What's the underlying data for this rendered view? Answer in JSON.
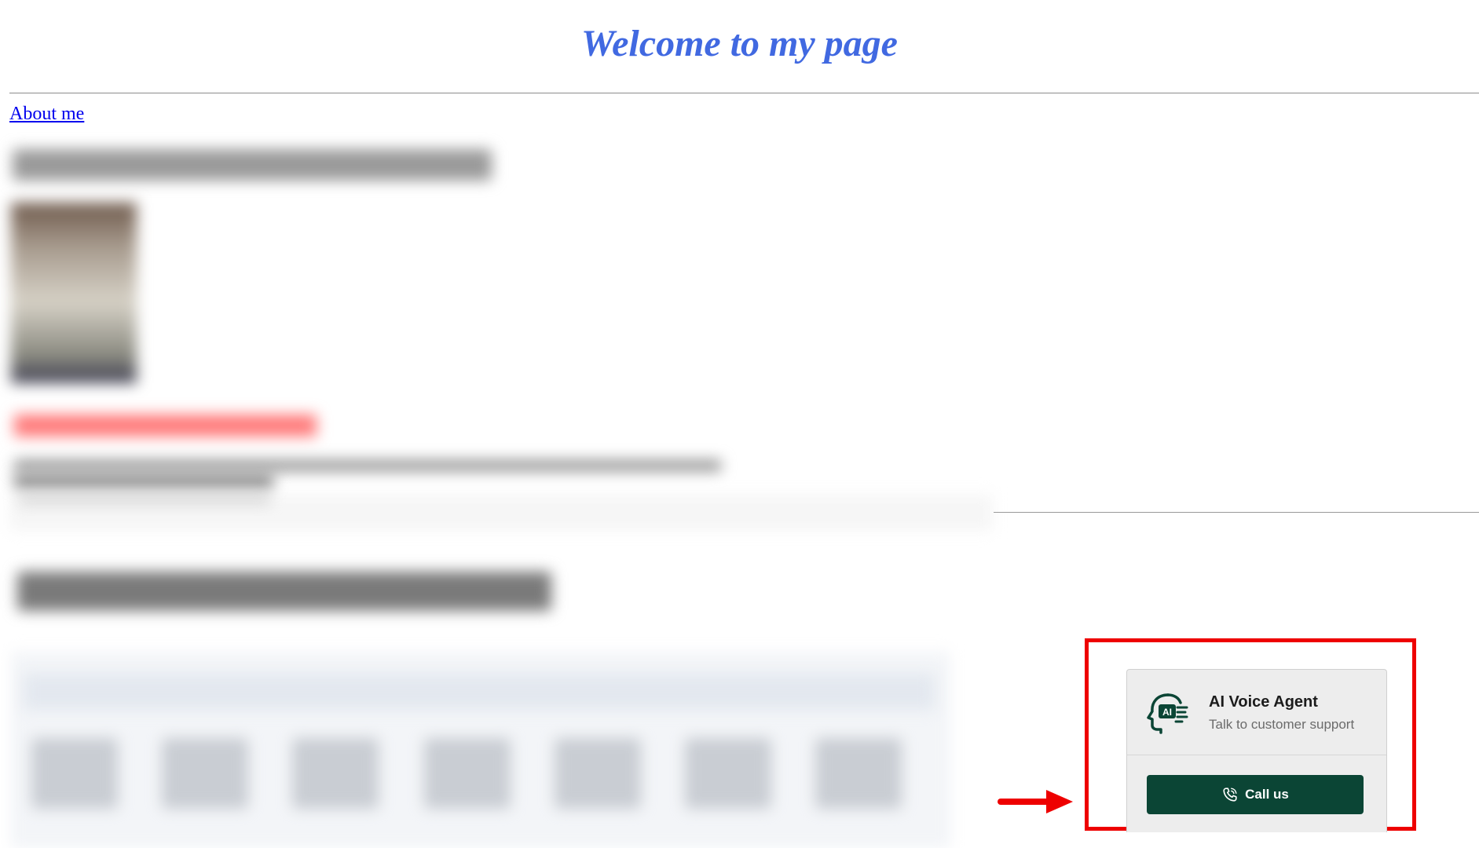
{
  "page": {
    "title": "Welcome to my page",
    "about_link": "About me"
  },
  "widget": {
    "title": "AI Voice Agent",
    "subtitle": "Talk to customer support",
    "call_label": "Call us",
    "icon": "ai-head-icon",
    "button_color": "#0b4535"
  },
  "annotations": {
    "highlight_color": "#ee0000",
    "arrow": "red-arrow-icon"
  }
}
